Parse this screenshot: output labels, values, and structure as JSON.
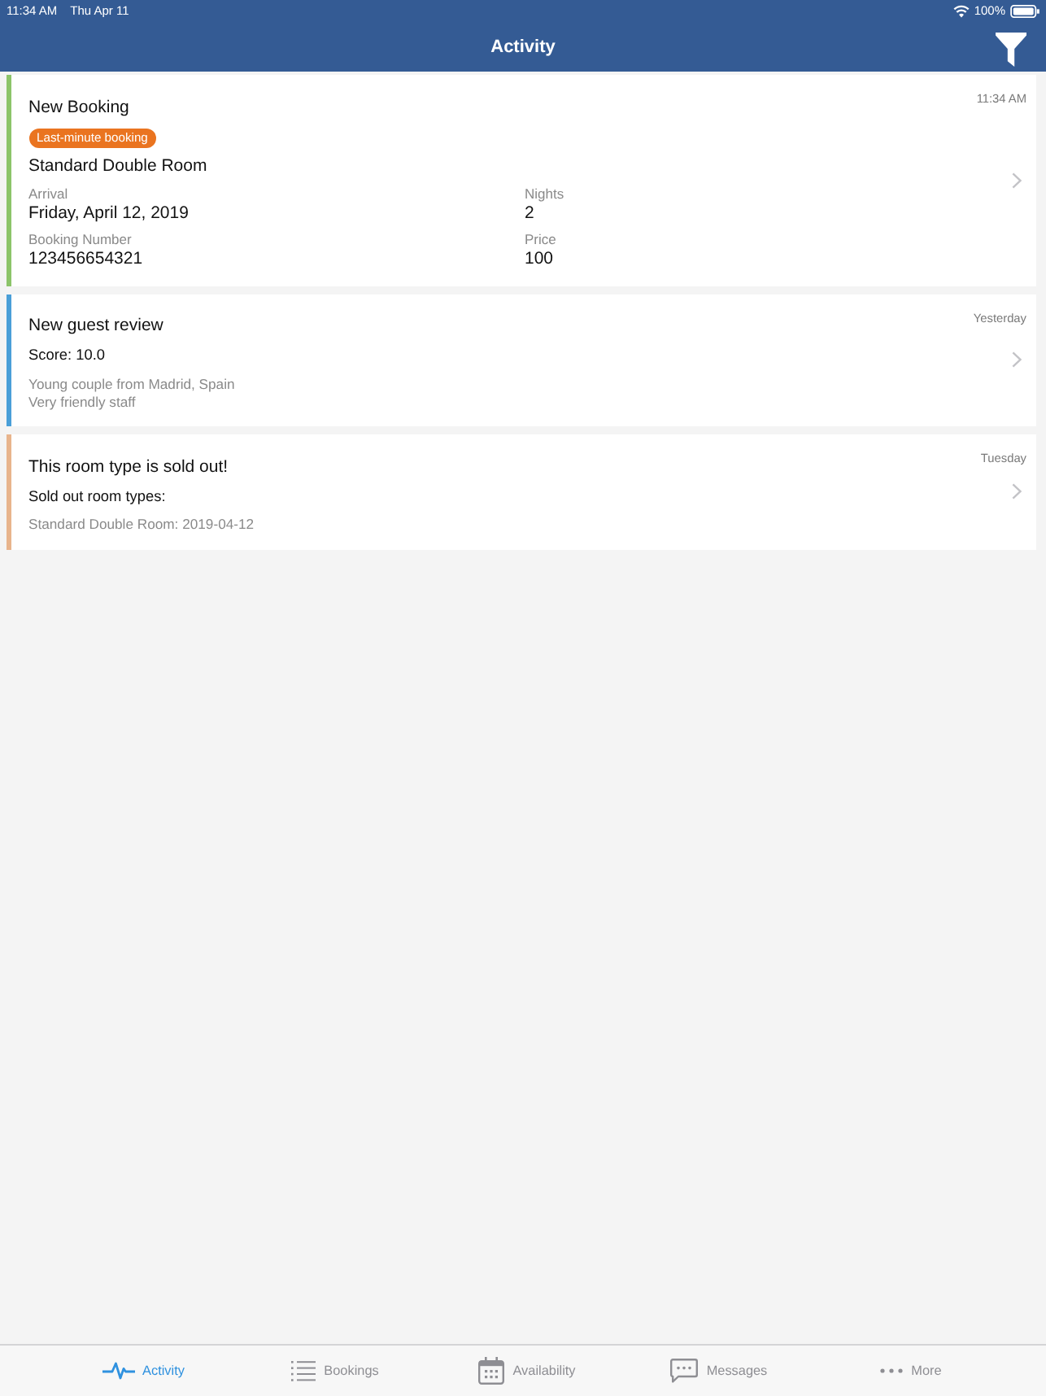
{
  "status_bar": {
    "time": "11:34 AM",
    "date": "Thu Apr 11",
    "battery": "100%"
  },
  "nav_bar": {
    "title": "Activity"
  },
  "activities": [
    {
      "kind": "booking",
      "color": "#8cc46a",
      "title": "New Booking",
      "time": "11:34 AM",
      "badge": "Last-minute booking",
      "room": "Standard Double Room",
      "fields": [
        {
          "label": "Arrival",
          "value": "Friday, April 12, 2019"
        },
        {
          "label": "Nights",
          "value": "2"
        },
        {
          "label": "Booking Number",
          "value": "123456654321"
        },
        {
          "label": "Price",
          "value": "100"
        }
      ]
    },
    {
      "kind": "review",
      "color": "#4a9fd8",
      "title": "New guest review",
      "time": "Yesterday",
      "subtitle": "Score: 10.0",
      "lines": [
        "Young couple from Madrid, Spain",
        "Very friendly staff"
      ]
    },
    {
      "kind": "sold_out",
      "color": "#e8b48c",
      "title": "This room type is sold out!",
      "time": "Tuesday",
      "subtitle": "Sold out room types:",
      "lines": [
        "Standard Double Room: 2019-04-12"
      ]
    }
  ],
  "tab_bar": [
    {
      "label": "Activity",
      "selected": true
    },
    {
      "label": "Bookings",
      "selected": false
    },
    {
      "label": "Availability",
      "selected": false
    },
    {
      "label": "Messages",
      "selected": false
    },
    {
      "label": "More",
      "selected": false
    }
  ]
}
